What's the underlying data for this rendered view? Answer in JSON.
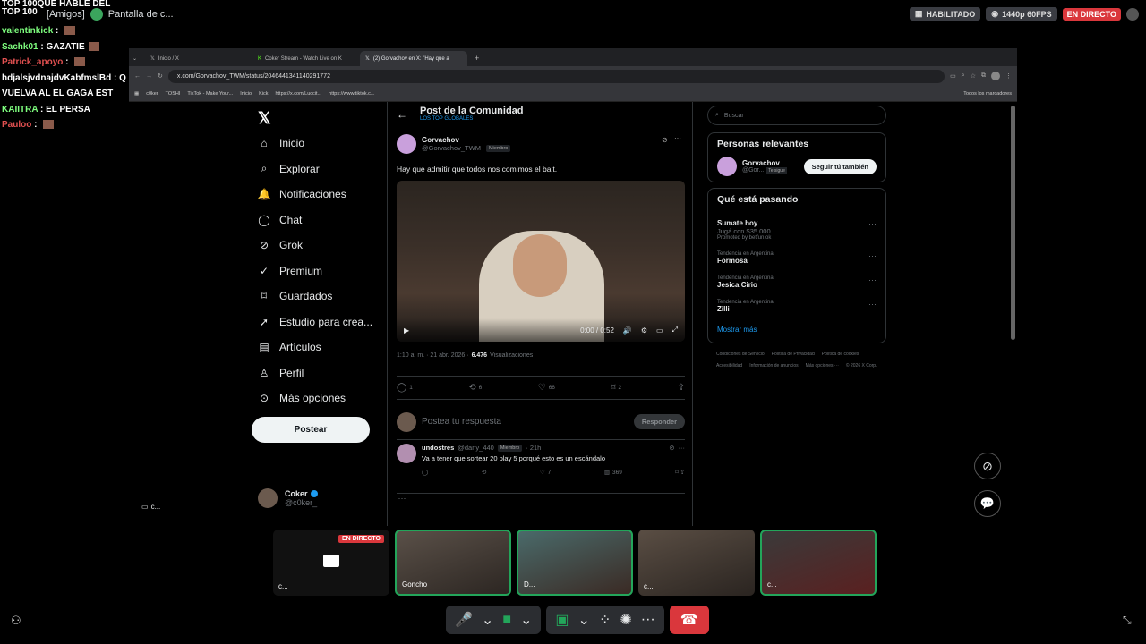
{
  "overlay": {
    "title_line1": "TOP 100QUE HABLE DEL",
    "title_line2": "TOP 100",
    "discord_group": "[Amigos]",
    "screen_share_label": "Pantalla de c...",
    "chat": [
      {
        "user": "valentinkick",
        "sep": " : ",
        "text": "",
        "emote": true,
        "color": "#7fff7f"
      },
      {
        "user": "Sachk01",
        "sep": " : ",
        "text": "GAZATIE",
        "emote": true,
        "color": "#7fff7f"
      },
      {
        "user": "Patrick_apoyo",
        "sep": " : ",
        "text": "",
        "emote": true,
        "color": "#e05050"
      },
      {
        "user": "hdjalsjvdnajdvKabfmslBd",
        "sep": " : ",
        "text": "Q VUELVA AL  EL GAGA EST",
        "emote": false,
        "color": "#ffffff"
      },
      {
        "user": "KAIITRA",
        "sep": " : ",
        "text": "EL PERSA",
        "emote": false,
        "color": "#7fff7f"
      },
      {
        "user": "Pauloo",
        "sep": " : ",
        "text": "",
        "emote": true,
        "color": "#e05050"
      }
    ]
  },
  "status_bar": {
    "enabled": "HABILITADO",
    "quality": "1440p 60FPS",
    "live": "EN DIRECTO"
  },
  "browser": {
    "tabs": [
      "Inicio / X",
      "Coker Stream - Watch Live on K",
      "(2) Gorvachov en X: \"Hay que a"
    ],
    "url": "x.com/Gorvachov_TWM/status/2046441341140291772",
    "bookmarks": [
      "c0ker",
      "TOSHI",
      "TikTok - Make Your...",
      "Inicio",
      "Kick",
      "https://x.com/Luccit...",
      "https://www.tiktok.c..."
    ],
    "bookmarks_right": "Todos los marcadores"
  },
  "nav": {
    "items": [
      {
        "label": "Inicio",
        "icon": "home-icon"
      },
      {
        "label": "Explorar",
        "icon": "search-icon"
      },
      {
        "label": "Notificaciones",
        "icon": "bell-icon"
      },
      {
        "label": "Chat",
        "icon": "chat-icon"
      },
      {
        "label": "Grok",
        "icon": "grok-icon"
      },
      {
        "label": "Premium",
        "icon": "premium-icon"
      },
      {
        "label": "Guardados",
        "icon": "bookmark-icon"
      },
      {
        "label": "Estudio para crea...",
        "icon": "rocket-icon"
      },
      {
        "label": "Artículos",
        "icon": "article-icon"
      },
      {
        "label": "Perfil",
        "icon": "person-icon"
      },
      {
        "label": "Más opciones",
        "icon": "more-circle-icon"
      }
    ],
    "post_button": "Postear",
    "account_name": "Coker",
    "account_handle": "@c0ker_"
  },
  "post": {
    "header_title": "Post de la Comunidad",
    "header_sub": "LOS TOP GLOBALES",
    "author_name": "Gorvachov",
    "author_handle": "@Gorvachov_TWM",
    "badge": "Miembro",
    "text": "Hay que admitir que todos nos comimos el bait.",
    "video_time": "0:00 / 0:52",
    "timestamp": "1:10 a. m. · 21 abr. 2026 ·",
    "views_count": "6.476",
    "views_label": "Visualizaciones",
    "replies": "1",
    "reposts": "6",
    "likes": "66",
    "bookmarks": "2",
    "reply_placeholder": "Postea tu respuesta",
    "reply_button": "Responder"
  },
  "reply": {
    "author": "undostres",
    "handle": "@dany_440",
    "badge": "Miembro",
    "time": "· 21h",
    "text": "Va a tener que sortear 20 play 5 porqué esto es un escándalo",
    "likes": "7",
    "views": "369"
  },
  "sidebar": {
    "search_placeholder": "Buscar",
    "relevant_title": "Personas relevantes",
    "relevant_name": "Gorvachov",
    "relevant_handle": "@Gor...",
    "follows_you": "Te sigue",
    "follow_button": "Seguir tú también",
    "happening_title": "Qué está pasando",
    "promo_title": "Sumate hoy",
    "promo_line": "Jugá con $35.000",
    "promo_by": "Promoted by betfun.ok",
    "trends": [
      {
        "context": "Tendencia en Argentina",
        "name": "Formosa"
      },
      {
        "context": "Tendencia en Argentina",
        "name": "Jesica Cirio"
      },
      {
        "context": "Tendencia en Argentina",
        "name": "Zilli"
      }
    ],
    "show_more": "Mostrar más",
    "footer": [
      "Condiciones de Servicio",
      "Política de Privacidad",
      "Política de cookies",
      "Accesibilidad",
      "Información de anuncios",
      "Más opciones ···",
      "© 2026 X Corp."
    ]
  },
  "call": {
    "left_label": "c...",
    "tile0_live": "EN DIRECTO",
    "tile0_label": "c...",
    "tile_labels": [
      "Goncho",
      "D...",
      "c...",
      "c..."
    ]
  },
  "colors": {
    "accent": "#1d9bf0",
    "live_red": "#da373c",
    "hangup": "#da373c",
    "tile_active_border": "#23a55a"
  }
}
